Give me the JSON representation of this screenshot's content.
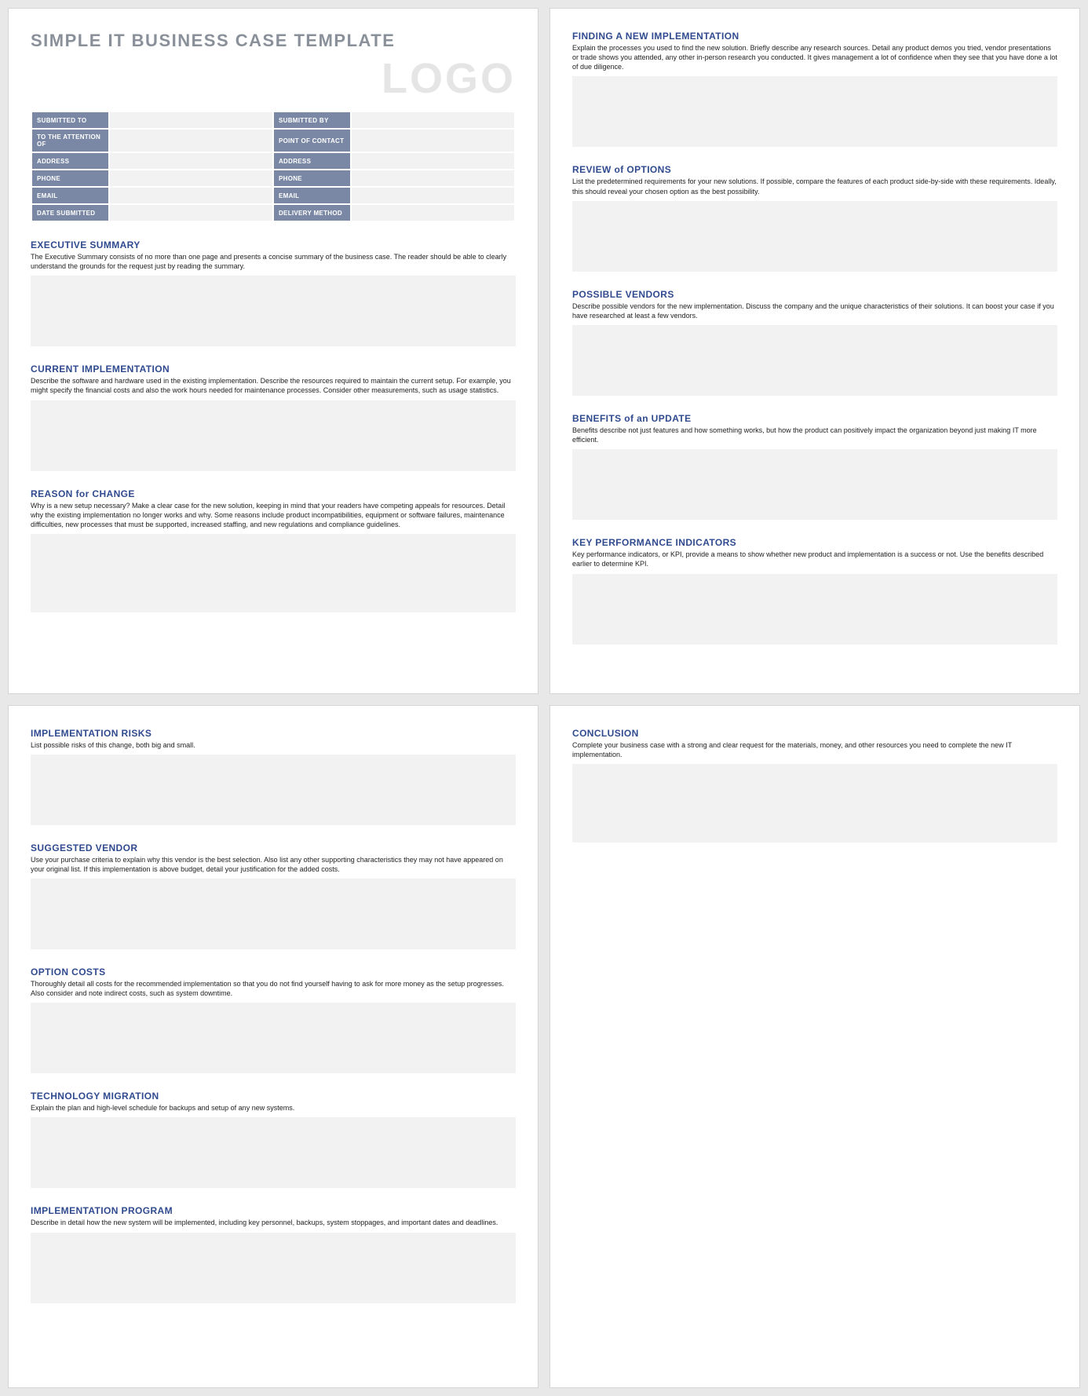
{
  "title": "SIMPLE IT BUSINESS CASE TEMPLATE",
  "logo": "LOGO",
  "meta": {
    "left": [
      {
        "k": "SUBMITTED TO",
        "v": ""
      },
      {
        "k": "TO THE ATTENTION OF",
        "v": ""
      },
      {
        "k": "ADDRESS",
        "v": ""
      },
      {
        "k": "PHONE",
        "v": ""
      },
      {
        "k": "EMAIL",
        "v": ""
      },
      {
        "k": "DATE SUBMITTED",
        "v": ""
      }
    ],
    "right": [
      {
        "k": "SUBMITTED BY",
        "v": ""
      },
      {
        "k": "POINT OF CONTACT",
        "v": ""
      },
      {
        "k": "ADDRESS",
        "v": ""
      },
      {
        "k": "PHONE",
        "v": ""
      },
      {
        "k": "EMAIL",
        "v": ""
      },
      {
        "k": "DELIVERY METHOD",
        "v": ""
      }
    ]
  },
  "sections": {
    "exec": {
      "h": "EXECUTIVE SUMMARY",
      "d": "The Executive Summary consists of no more than one page and presents a concise summary of the business case. The reader should be able to clearly understand the grounds for the request just by reading the summary."
    },
    "curr": {
      "h": "CURRENT IMPLEMENTATION",
      "d": "Describe the software and hardware used in the existing implementation. Describe the resources required to maintain the current setup. For example, you might specify the financial costs and also the work hours needed for maintenance processes. Consider other measurements, such as usage statistics."
    },
    "reason": {
      "h": "REASON for CHANGE",
      "d": "Why is a new setup necessary? Make a clear case for the new solution, keeping in mind that your readers have competing appeals for resources. Detail why the existing implementation no longer works and why. Some reasons include product incompatibilities, equipment or software failures, maintenance difficulties, new processes that must be supported, increased staffing, and new regulations and compliance guidelines."
    },
    "find": {
      "h": "FINDING A NEW IMPLEMENTATION",
      "d": "Explain the processes you used to find the new solution. Briefly describe any research sources. Detail any product demos you tried, vendor presentations or trade shows you attended, any other in-person research you conducted. It gives management a lot of confidence when they see that you have done a lot of due diligence."
    },
    "review": {
      "h": "REVIEW of OPTIONS",
      "d": "List the predetermined requirements for your new solutions. If possible, compare the features of each product side-by-side with these requirements. Ideally, this should reveal your chosen option as the best possibility."
    },
    "vendors": {
      "h": "POSSIBLE VENDORS",
      "d": "Describe possible vendors for the new implementation. Discuss the company and the unique characteristics of their solutions. It can boost your case if you have researched at least a few vendors."
    },
    "benefits": {
      "h": "BENEFITS of an UPDATE",
      "d": "Benefits describe not just features and how something works, but how the product can positively impact the organization beyond just making IT more efficient."
    },
    "kpi": {
      "h": "KEY PERFORMANCE INDICATORS",
      "d": "Key performance indicators, or KPI, provide a means to show whether new product and implementation is a success or not. Use the benefits described earlier to determine KPI."
    },
    "risks": {
      "h": "IMPLEMENTATION RISKS",
      "d": "List possible risks of this change, both big and small."
    },
    "suggested": {
      "h": "SUGGESTED VENDOR",
      "d": "Use your purchase criteria to explain why this vendor is the best selection. Also list any other supporting characteristics they may not have appeared on your original list. If this implementation is above budget, detail your justification for the added costs."
    },
    "costs": {
      "h": "OPTION COSTS",
      "d": "Thoroughly detail all costs for the recommended implementation so that you do not find yourself having to ask for more money as the setup progresses. Also consider and note indirect costs, such as system downtime."
    },
    "migration": {
      "h": "TECHNOLOGY MIGRATION",
      "d": "Explain the plan and high-level schedule for backups and setup of any new systems."
    },
    "program": {
      "h": "IMPLEMENTATION PROGRAM",
      "d": "Describe in detail how the new system will be implemented, including key personnel, backups, system stoppages, and important dates and deadlines."
    },
    "conclusion": {
      "h": "CONCLUSION",
      "d": "Complete your business case with a strong and clear request for the materials, money, and other resources you need to complete the new IT implementation."
    }
  }
}
